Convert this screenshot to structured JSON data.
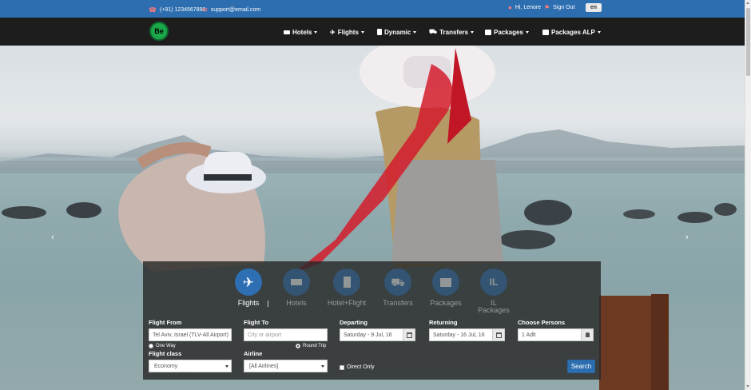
{
  "topbar": {
    "phone": "(+91) 1234567890",
    "email": "support@email.com",
    "greeting": "Hi, Lenore",
    "signout": "Sign Out",
    "language": "en"
  },
  "logo": {
    "main": "Be",
    "sub": ""
  },
  "nav": {
    "items": [
      {
        "label": "Hotels",
        "icon": "bed-icon"
      },
      {
        "label": "Flights",
        "icon": "plane-icon"
      },
      {
        "label": "Dynamic",
        "icon": "dynamic-icon"
      },
      {
        "label": "Transfers",
        "icon": "road-icon"
      },
      {
        "label": "Packages",
        "icon": "briefcase-icon"
      },
      {
        "label": "Packages ALP",
        "icon": "briefcase-icon"
      }
    ]
  },
  "carousel": {
    "prev": "‹",
    "next": "›"
  },
  "search": {
    "tabs": [
      {
        "label": "Flights",
        "icon": "plane-icon",
        "active": true
      },
      {
        "label": "Hotels",
        "icon": "bed-icon",
        "active": false
      },
      {
        "label": "Hotel+Flight",
        "icon": "hotel-flight-icon",
        "active": false
      },
      {
        "label": "Transfers",
        "icon": "road-icon",
        "active": false
      },
      {
        "label": "Packages",
        "icon": "briefcase-icon",
        "active": false
      },
      {
        "label": "IL Packages",
        "icon": "il-icon",
        "active": false
      }
    ],
    "flight_from": {
      "label": "Flight From",
      "value": "Tel Aviv, Israel (TLV-All Airport)"
    },
    "flight_to": {
      "label": "Flight To",
      "placeholder": "City or airport"
    },
    "departing": {
      "label": "Departing",
      "value": "Saturday - 9 Jul, 16"
    },
    "returning": {
      "label": "Returning",
      "value": "Saturday - 16 Jul, 16"
    },
    "persons": {
      "label": "Choose Persons",
      "value": "1 Adlt"
    },
    "trip_type": {
      "one_way": "One Way",
      "round_trip": "Round Trip",
      "selected": "Round Trip"
    },
    "flight_class": {
      "label": "Flight class",
      "value": "Economy"
    },
    "airline": {
      "label": "Airline",
      "value": "[All Airlines]"
    },
    "direct_only": {
      "label": "Direct Only",
      "checked": false
    },
    "search_button": "Search"
  },
  "colors": {
    "primary": "#2c6eb0",
    "nav_bg": "#1d1d1d",
    "panel_bg": "rgba(40,40,40,0.82)"
  }
}
